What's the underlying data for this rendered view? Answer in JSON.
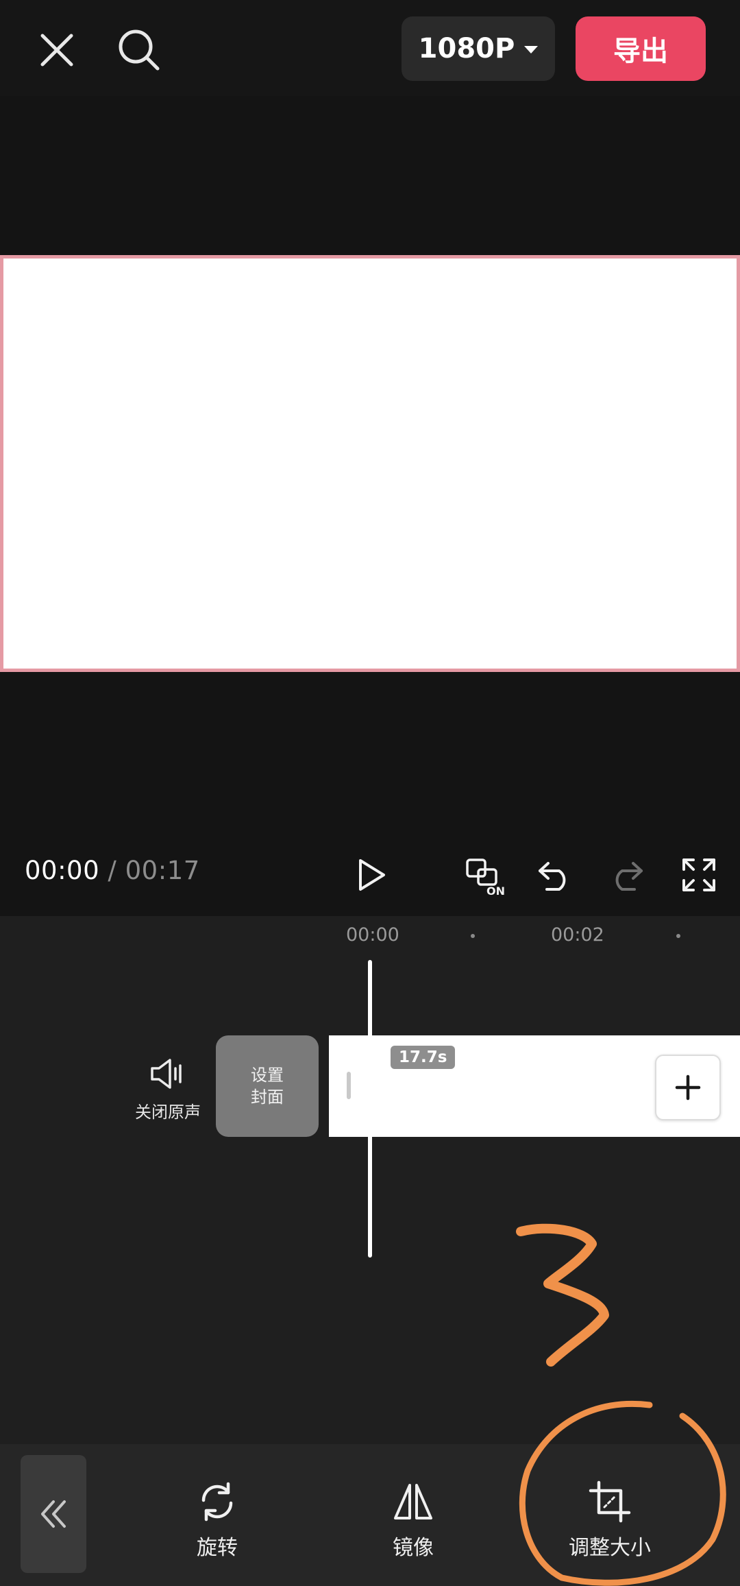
{
  "header": {
    "close_icon": "close-icon",
    "search_icon": "search-icon",
    "resolution": "1080P",
    "export_label": "导出"
  },
  "playback": {
    "current_time": "00:00",
    "separator": "/",
    "total_time": "00:17",
    "controls": [
      "play-icon",
      "keyframe-on-icon",
      "undo-icon",
      "redo-icon",
      "fullscreen-icon"
    ]
  },
  "timeline": {
    "ruler": [
      "00:00",
      "00:02"
    ],
    "mute_label": "关闭原声",
    "cover_label_line1": "设置",
    "cover_label_line2": "封面",
    "clip_duration": "17.7s"
  },
  "toolbar": {
    "back_icon": "double-chevron-left-icon",
    "rotate_label": "旋转",
    "mirror_label": "镜像",
    "resize_label": "调整大小"
  },
  "annotation": {
    "number": "3",
    "color": "#f0914a"
  },
  "colors": {
    "accent": "#ea4662",
    "preview_border": "#e59aa4"
  }
}
